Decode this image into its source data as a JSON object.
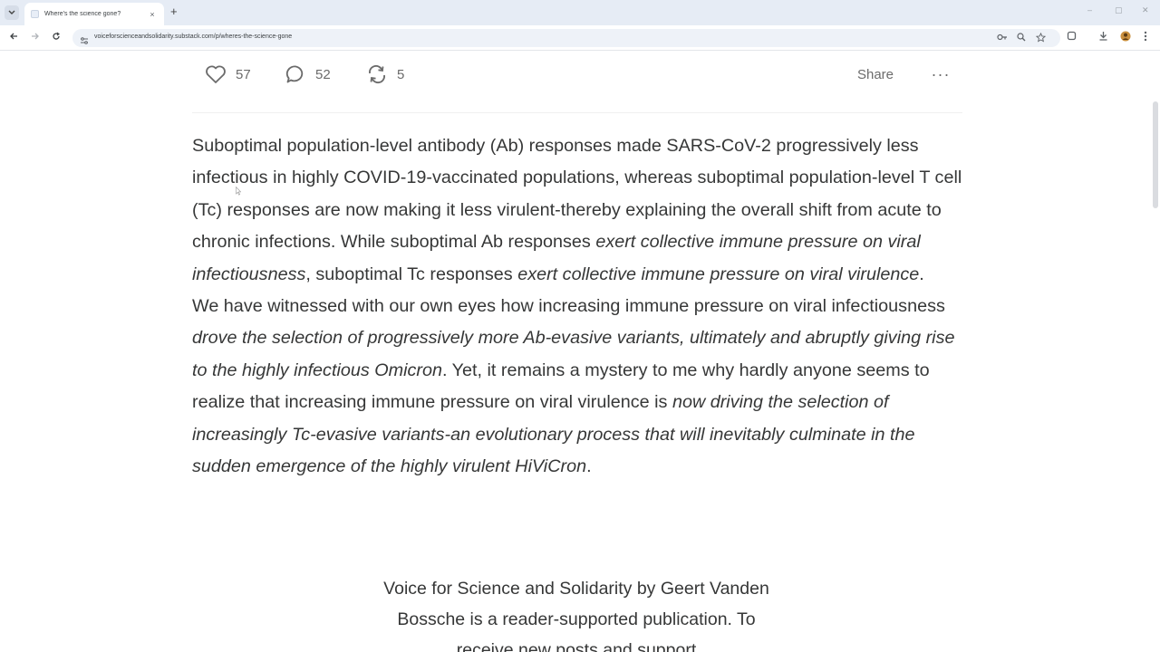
{
  "browser": {
    "tab_title": "Where's the science gone?",
    "tab_close": "×",
    "new_tab": "+",
    "url": "voiceforscienceandsolidarity.substack.com/p/wheres-the-science-gone",
    "window_controls": [
      "–",
      "▢",
      "✕"
    ]
  },
  "actions": {
    "likes": "57",
    "comments": "52",
    "restacks": "5",
    "share_label": "Share",
    "more_label": "···"
  },
  "article": {
    "p1_a": "Suboptimal population-level antibody (Ab) responses made SARS-CoV-2 progressively less infectious in highly COVID-19-vaccinated populations, whereas suboptimal population-level T cell (Tc) responses are now making it less virulent-thereby explaining the overall shift from acute to chronic infections. While suboptimal Ab responses ",
    "p1_b": "exert collective immune pressure on viral infectiousness",
    "p1_c": ", suboptimal Tc responses ",
    "p1_d": "exert collective immune pressure on viral virulence",
    "p1_e": ".",
    "p2_a": "We have witnessed with our own eyes how increasing immune pressure on viral infectiousness ",
    "p2_b": "drove the selection of progressively more Ab-evasive variants, ultimately and abruptly giving rise to the highly infectious Omicron",
    "p2_c": ". Yet, it remains a mystery to me why hardly anyone seems to realize that increasing immune pressure on viral virulence is ",
    "p2_d": "now driving the selection of increasingly Tc-evasive variants-an evolutionary process that will inevitably culminate in the sudden emergence of the highly virulent HiViCron",
    "p2_e": "."
  },
  "subscribe": {
    "text": "Voice for Science and Solidarity by Geert Vanden Bossche is a reader-supported publication. To receive new posts and support"
  },
  "colors": {
    "body_text": "#363737",
    "muted": "#6b6b6b",
    "chrome_bg": "#e6ecf5"
  },
  "icons": [
    "tab-list-icon",
    "favicon-icon",
    "back-icon",
    "forward-icon",
    "reload-icon",
    "site-info-icon",
    "password-key-icon",
    "zoom-icon",
    "bookmark-star-icon",
    "extensions-icon",
    "download-icon",
    "profile-icon",
    "menu-icon",
    "heart-icon",
    "comment-icon",
    "restack-icon"
  ]
}
